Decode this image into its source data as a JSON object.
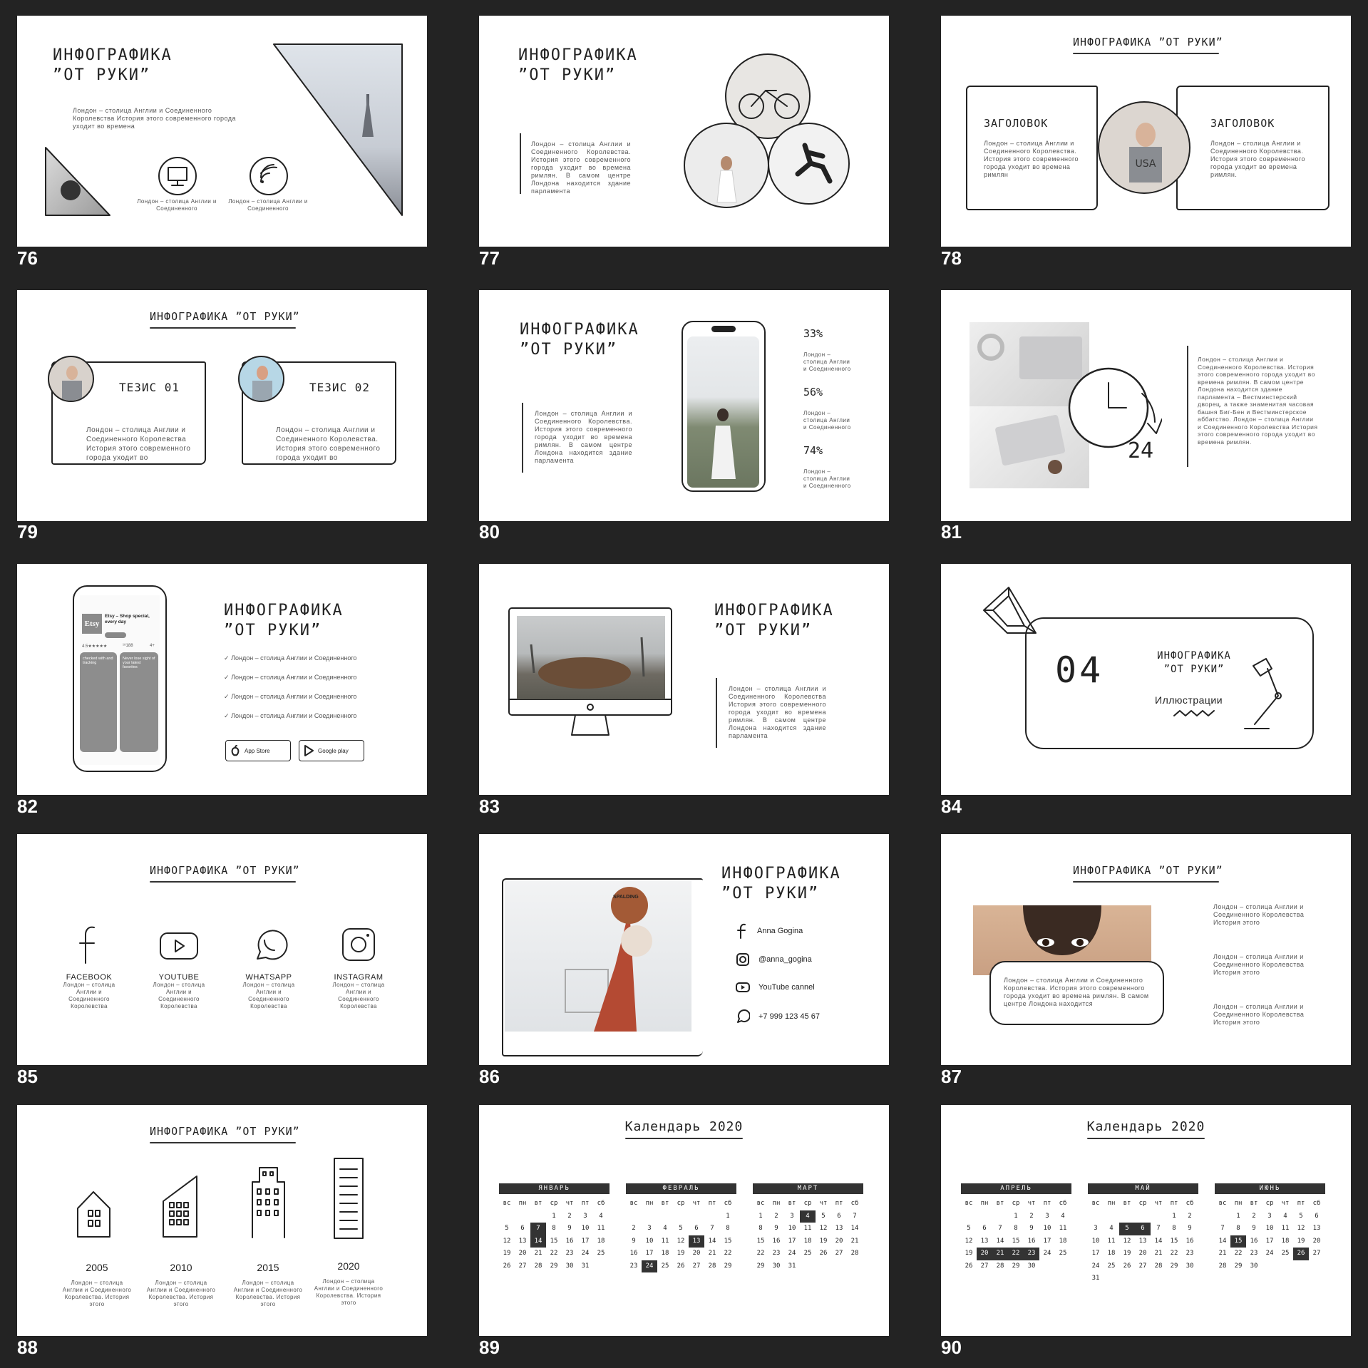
{
  "slides": [
    {
      "number": "76",
      "title": "ИНФОГРАФИКА\n”ОТ РУКИ”",
      "text": "Лондон – столица Англии и Соединенного Королевства История этого современного города уходит во времена",
      "icon_captions": [
        "Лондон – столица Англии и Соединенного",
        "Лондон – столица Англии и Соединенного"
      ],
      "icons": [
        "monitor-icon",
        "wifi-icon"
      ]
    },
    {
      "number": "77",
      "title": "ИНФОГРАФИКА\n”ОТ РУКИ”",
      "text": "Лондон – столица Англии и Соединенного Королевства. История этого современного города уходит во времена римлян. В самом центре Лондона находится здание парламента"
    },
    {
      "number": "78",
      "title": "ИНФОГРАФИКА ”ОТ РУКИ”",
      "boxes": [
        {
          "heading": "ЗАГОЛОВОК",
          "text": "Лондон – столица Англии и Соединенного Королевства. История этого современного города уходит во времена римлян"
        },
        {
          "heading": "ЗАГОЛОВОК",
          "text": "Лондон – столица Англии и Соединенного Королевства. История этого современного города уходит во времена римлян."
        }
      ]
    },
    {
      "number": "79",
      "title": "ИНФОГРАФИКА ”ОТ РУКИ”",
      "boxes": [
        {
          "heading": "ТЕЗИС 01",
          "text": "Лондон – столица Англии и Соединенного Королевства История этого современного города уходит во"
        },
        {
          "heading": "ТЕЗИС 02",
          "text": "Лондон – столица Англии и Соединенного Королевства. История этого современного города уходит во"
        }
      ]
    },
    {
      "number": "80",
      "title": "ИНФОГРАФИКА\n”ОТ РУКИ”",
      "text": "Лондон – столица Англии и Соединенного Королевства. История этого современного города уходит во времена римлян. В самом центре Лондона находится здание парламента",
      "stats": [
        {
          "value": "33%",
          "text": "Лондон – столица Англии и Соединенного"
        },
        {
          "value": "56%",
          "text": "Лондон – столица Англии и Соединенного"
        },
        {
          "value": "74%",
          "text": "Лондон – столица Англии и Соединенного"
        }
      ]
    },
    {
      "number": "81",
      "clock_label": "24",
      "text": "Лондон – столица Англии и Соединенного Королевства. История этого современного города уходит во времена римлян. В самом центре Лондона находится здание парламента – Вестминстерский дворец, а также знаменитая часовая башня Биг-Бен и Вестминстерское аббатство. Лондон – столица Англии и Соединенного Королевства История этого современного города уходит во времена римлян."
    },
    {
      "number": "82",
      "title": "ИНФОГРАФИКА\n”ОТ РУКИ”",
      "checks": [
        "Лондон – столица Англии и Соединенного",
        "Лондон – столица Англии и Соединенного",
        "Лондон – столица Англии и Соединенного",
        "Лондон – столица Англии и Соединенного"
      ],
      "buttons": [
        "App Store",
        "Google play"
      ],
      "phone": {
        "app_name": "Etsy – Shop special, every day",
        "logo": "Etsy",
        "rating": "4.5★★★★★",
        "count": "¹⁸188",
        "age": "4+",
        "banner_left": "checked with and tracking",
        "banner_right": "Never lose sight of your latest favorites"
      }
    },
    {
      "number": "83",
      "title": "ИНФОГРАФИКА\n”ОТ РУКИ”",
      "text": "Лондон – столица Англии и Соединенного Королевства История этого современного города уходит во времена римлян. В самом центре Лондона находится здание парламента"
    },
    {
      "number": "84",
      "section_number": "04",
      "title": "ИНФОГРАФИКА\n”ОТ РУКИ”",
      "subtitle": "Иллюстрации"
    },
    {
      "number": "85",
      "title": "ИНФОГРАФИКА ”ОТ РУКИ”",
      "socials": [
        {
          "label": "FACEBOOK",
          "text": "Лондон – столица Англии и Соединенного Королевства"
        },
        {
          "label": "YOUTUBE",
          "text": "Лондон – столица Англии и Соединенного Королевства"
        },
        {
          "label": "WHATSAPP",
          "text": "Лондон – столица Англии и Соединенного Королевства"
        },
        {
          "label": "INSTAGRAM",
          "text": "Лондон – столица Англии и Соединенного Королевства"
        }
      ]
    },
    {
      "number": "86",
      "title": "ИНФОГРАФИКА\n”ОТ РУКИ”",
      "contacts": [
        {
          "icon": "facebook-icon",
          "text": "Anna Gogina"
        },
        {
          "icon": "instagram-icon",
          "text": "@anna_gogina"
        },
        {
          "icon": "youtube-icon",
          "text": "YouTube cannel"
        },
        {
          "icon": "whatsapp-icon",
          "text": "+7 999 123 45 67"
        }
      ],
      "ball_text": "SPALDING"
    },
    {
      "number": "87",
      "title": "ИНФОГРАФИКА ”ОТ РУКИ”",
      "bubble_text": "Лондон – столица Англии и Соединенного Королевства. История этого современного города уходит во времена римлян. В самом центре Лондона находится",
      "notes": [
        "Лондон – столица Англии и Соединенного Королевства История этого",
        "Лондон – столица Англии и Соединенного Королевства История этого",
        "Лондон – столица Англии и Соединенного Королевства История этого"
      ]
    },
    {
      "number": "88",
      "title": "ИНФОГРАФИКА ”ОТ РУКИ”",
      "years": [
        {
          "year": "2005",
          "text": "Лондон – столица Англии и Соединенного Королевства. История этого"
        },
        {
          "year": "2010",
          "text": "Лондон – столица Англии и Соединенного Королевства. История этого"
        },
        {
          "year": "2015",
          "text": "Лондон – столица Англии и Соединенного Королевства. История этого"
        },
        {
          "year": "2020",
          "text": "Лондон – столица Англии и Соединенного Королевства. История этого"
        }
      ]
    },
    {
      "number": "89",
      "title": "Календарь 2020"
    },
    {
      "number": "90",
      "title": "Календарь 2020"
    }
  ],
  "calendar": {
    "weekdays": [
      "вс",
      "пн",
      "вт",
      "ср",
      "чт",
      "пт",
      "сб"
    ],
    "months": [
      {
        "name": "ЯНВАРЬ",
        "offset": 3,
        "days": 31,
        "highlight": [
          7,
          14
        ]
      },
      {
        "name": "ФЕВРАЛЬ",
        "offset": 6,
        "days": 29,
        "highlight": [
          13,
          24
        ]
      },
      {
        "name": "МАРТ",
        "offset": 0,
        "days": 31,
        "highlight": [
          4
        ]
      },
      {
        "name": "АПРЕЛЬ",
        "offset": 3,
        "days": 30,
        "highlight": [
          20,
          21,
          22,
          23
        ]
      },
      {
        "name": "МАЙ",
        "offset": 5,
        "days": 31,
        "highlight": [
          5,
          6
        ]
      },
      {
        "name": "ИЮНЬ",
        "offset": 1,
        "days": 30,
        "highlight": [
          15,
          26
        ]
      }
    ]
  }
}
